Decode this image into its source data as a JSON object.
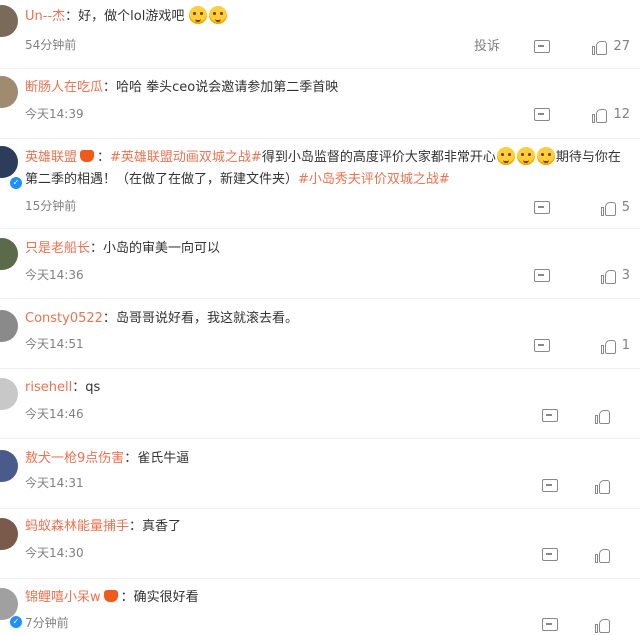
{
  "report_label": "投诉",
  "comments": [
    {
      "user": "Un--杰",
      "sep": "：",
      "text": "好，做个lol游戏吧",
      "time": "54分钟前",
      "likes": "27",
      "emoji_count": 2,
      "verified": false,
      "has_report": true
    },
    {
      "user": "断肠人在吃瓜",
      "sep": "：",
      "text": "哈哈 拳头ceo说会邀请参加第二季首映",
      "time": "今天14:39",
      "likes": "12",
      "verified": false,
      "has_report": false
    },
    {
      "user": "英雄联盟",
      "sep": "：",
      "topic1": "#英雄联盟动画双城之战#",
      "text_a": "得到小岛监督的高度评价大家都非常开心",
      "text_b": "期待与你在",
      "line2": "第二季的相遇！（在做了在做了，新建文件夹）",
      "topic2": "#小岛秀夫评价双城之战#",
      "time": "15分钟前",
      "likes": "5",
      "verified": true,
      "has_report": false
    },
    {
      "user": "只是老船长",
      "sep": "：",
      "text": "小岛的审美一向可以",
      "time": "今天14:36",
      "likes": "3",
      "verified": false,
      "has_report": false
    },
    {
      "user": "Consty0522",
      "sep": "：",
      "text": "岛哥哥说好看，我这就滚去看。",
      "time": "今天14:51",
      "likes": "1",
      "verified": false,
      "has_report": false
    },
    {
      "user": "risehell",
      "sep": "：",
      "text": "qs",
      "time": "今天14:46",
      "likes": "",
      "verified": false,
      "has_report": false
    },
    {
      "user": "敖犬一枪9点伤害",
      "sep": "：",
      "text": "雀氏牛逼",
      "time": "今天14:31",
      "likes": "",
      "verified": false,
      "has_report": false
    },
    {
      "user": "蚂蚁森林能量捕手",
      "sep": "：",
      "text": "真香了",
      "time": "今天14:30",
      "likes": "",
      "verified": false,
      "has_report": false
    },
    {
      "user": "锦鲤嘻小呆w",
      "sep": "：",
      "text": "确实很好看",
      "time": "7分钟前",
      "likes": "",
      "verified": true,
      "has_report": false
    }
  ]
}
